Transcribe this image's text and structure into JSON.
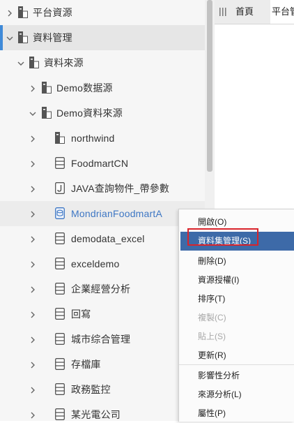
{
  "tree": {
    "items": [
      {
        "label": "平台資源",
        "icon": "folder-doc-icon",
        "chevron": "right"
      },
      {
        "label": "資料管理",
        "icon": "folder-doc-icon",
        "chevron": "down",
        "selected": true
      },
      {
        "label": "資料來源",
        "icon": "folder-doc-icon",
        "chevron": "down"
      },
      {
        "label": "Demo数据源",
        "icon": "folder-doc-icon",
        "chevron": "right"
      },
      {
        "label": "Demo資料來源",
        "icon": "folder-doc-icon",
        "chevron": "down"
      },
      {
        "label": "northwind",
        "icon": "folder-doc-icon",
        "chevron": "right"
      },
      {
        "label": "FoodmartCN",
        "icon": "database-icon",
        "chevron": "right"
      },
      {
        "label": "JAVA查詢物件_帶參數",
        "icon": "java-object-icon",
        "chevron": "right"
      },
      {
        "label": "MondrianFoodmartA",
        "icon": "cube-icon",
        "chevron": "right",
        "active": true
      },
      {
        "label": "demodata_excel",
        "icon": "database-icon",
        "chevron": "right"
      },
      {
        "label": "exceldemo",
        "icon": "database-icon",
        "chevron": "right"
      },
      {
        "label": "企業經營分析",
        "icon": "database-icon",
        "chevron": "right"
      },
      {
        "label": "回寫",
        "icon": "database-icon",
        "chevron": "right"
      },
      {
        "label": "城市综合管理",
        "icon": "database-icon",
        "chevron": "right"
      },
      {
        "label": "存檔庫",
        "icon": "database-icon",
        "chevron": "right"
      },
      {
        "label": "政務監控",
        "icon": "database-icon",
        "chevron": "right"
      },
      {
        "label": "某光電公司",
        "icon": "database-icon",
        "chevron": "right"
      }
    ]
  },
  "tabs": {
    "home": "首頁",
    "platform": "平台管"
  },
  "context_menu": {
    "items": [
      {
        "label": "開啟(O)",
        "disabled": false
      },
      {
        "label": "資料集管理(S)",
        "disabled": false,
        "highlighted": true
      },
      {
        "label": "刪除(D)",
        "disabled": false
      },
      {
        "label": "資源授權(I)",
        "disabled": false
      },
      {
        "label": "排序(T)",
        "disabled": false
      },
      {
        "label": "複製(C)",
        "disabled": true
      },
      {
        "label": "貼上(S)",
        "disabled": true
      },
      {
        "label": "更新(R)",
        "disabled": false
      },
      {
        "label": "影響性分析",
        "disabled": false
      },
      {
        "label": "來源分析(L)",
        "disabled": false
      },
      {
        "label": "屬性(P)",
        "disabled": false
      }
    ]
  },
  "colors": {
    "accent": "#3f8ad8",
    "active_text": "#3e77c4",
    "menu_highlight": "#3d6aa8",
    "focus_outline": "#d9232a"
  }
}
